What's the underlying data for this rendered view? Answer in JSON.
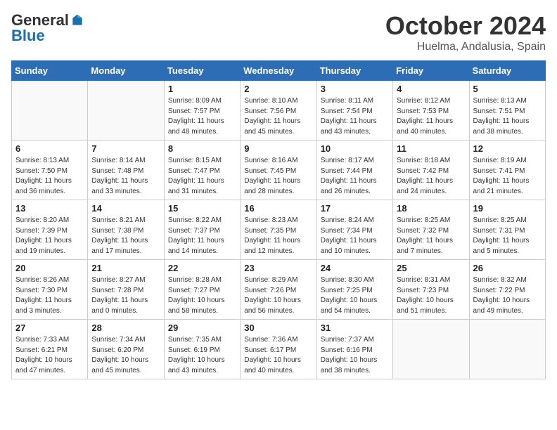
{
  "header": {
    "logo_general": "General",
    "logo_blue": "Blue",
    "title": "October 2024",
    "subtitle": "Huelma, Andalusia, Spain"
  },
  "weekdays": [
    "Sunday",
    "Monday",
    "Tuesday",
    "Wednesday",
    "Thursday",
    "Friday",
    "Saturday"
  ],
  "weeks": [
    [
      {
        "day": "",
        "info": ""
      },
      {
        "day": "",
        "info": ""
      },
      {
        "day": "1",
        "info": "Sunrise: 8:09 AM\nSunset: 7:57 PM\nDaylight: 11 hours and 48 minutes."
      },
      {
        "day": "2",
        "info": "Sunrise: 8:10 AM\nSunset: 7:56 PM\nDaylight: 11 hours and 45 minutes."
      },
      {
        "day": "3",
        "info": "Sunrise: 8:11 AM\nSunset: 7:54 PM\nDaylight: 11 hours and 43 minutes."
      },
      {
        "day": "4",
        "info": "Sunrise: 8:12 AM\nSunset: 7:53 PM\nDaylight: 11 hours and 40 minutes."
      },
      {
        "day": "5",
        "info": "Sunrise: 8:13 AM\nSunset: 7:51 PM\nDaylight: 11 hours and 38 minutes."
      }
    ],
    [
      {
        "day": "6",
        "info": "Sunrise: 8:13 AM\nSunset: 7:50 PM\nDaylight: 11 hours and 36 minutes."
      },
      {
        "day": "7",
        "info": "Sunrise: 8:14 AM\nSunset: 7:48 PM\nDaylight: 11 hours and 33 minutes."
      },
      {
        "day": "8",
        "info": "Sunrise: 8:15 AM\nSunset: 7:47 PM\nDaylight: 11 hours and 31 minutes."
      },
      {
        "day": "9",
        "info": "Sunrise: 8:16 AM\nSunset: 7:45 PM\nDaylight: 11 hours and 28 minutes."
      },
      {
        "day": "10",
        "info": "Sunrise: 8:17 AM\nSunset: 7:44 PM\nDaylight: 11 hours and 26 minutes."
      },
      {
        "day": "11",
        "info": "Sunrise: 8:18 AM\nSunset: 7:42 PM\nDaylight: 11 hours and 24 minutes."
      },
      {
        "day": "12",
        "info": "Sunrise: 8:19 AM\nSunset: 7:41 PM\nDaylight: 11 hours and 21 minutes."
      }
    ],
    [
      {
        "day": "13",
        "info": "Sunrise: 8:20 AM\nSunset: 7:39 PM\nDaylight: 11 hours and 19 minutes."
      },
      {
        "day": "14",
        "info": "Sunrise: 8:21 AM\nSunset: 7:38 PM\nDaylight: 11 hours and 17 minutes."
      },
      {
        "day": "15",
        "info": "Sunrise: 8:22 AM\nSunset: 7:37 PM\nDaylight: 11 hours and 14 minutes."
      },
      {
        "day": "16",
        "info": "Sunrise: 8:23 AM\nSunset: 7:35 PM\nDaylight: 11 hours and 12 minutes."
      },
      {
        "day": "17",
        "info": "Sunrise: 8:24 AM\nSunset: 7:34 PM\nDaylight: 11 hours and 10 minutes."
      },
      {
        "day": "18",
        "info": "Sunrise: 8:25 AM\nSunset: 7:32 PM\nDaylight: 11 hours and 7 minutes."
      },
      {
        "day": "19",
        "info": "Sunrise: 8:25 AM\nSunset: 7:31 PM\nDaylight: 11 hours and 5 minutes."
      }
    ],
    [
      {
        "day": "20",
        "info": "Sunrise: 8:26 AM\nSunset: 7:30 PM\nDaylight: 11 hours and 3 minutes."
      },
      {
        "day": "21",
        "info": "Sunrise: 8:27 AM\nSunset: 7:28 PM\nDaylight: 11 hours and 0 minutes."
      },
      {
        "day": "22",
        "info": "Sunrise: 8:28 AM\nSunset: 7:27 PM\nDaylight: 10 hours and 58 minutes."
      },
      {
        "day": "23",
        "info": "Sunrise: 8:29 AM\nSunset: 7:26 PM\nDaylight: 10 hours and 56 minutes."
      },
      {
        "day": "24",
        "info": "Sunrise: 8:30 AM\nSunset: 7:25 PM\nDaylight: 10 hours and 54 minutes."
      },
      {
        "day": "25",
        "info": "Sunrise: 8:31 AM\nSunset: 7:23 PM\nDaylight: 10 hours and 51 minutes."
      },
      {
        "day": "26",
        "info": "Sunrise: 8:32 AM\nSunset: 7:22 PM\nDaylight: 10 hours and 49 minutes."
      }
    ],
    [
      {
        "day": "27",
        "info": "Sunrise: 7:33 AM\nSunset: 6:21 PM\nDaylight: 10 hours and 47 minutes."
      },
      {
        "day": "28",
        "info": "Sunrise: 7:34 AM\nSunset: 6:20 PM\nDaylight: 10 hours and 45 minutes."
      },
      {
        "day": "29",
        "info": "Sunrise: 7:35 AM\nSunset: 6:19 PM\nDaylight: 10 hours and 43 minutes."
      },
      {
        "day": "30",
        "info": "Sunrise: 7:36 AM\nSunset: 6:17 PM\nDaylight: 10 hours and 40 minutes."
      },
      {
        "day": "31",
        "info": "Sunrise: 7:37 AM\nSunset: 6:16 PM\nDaylight: 10 hours and 38 minutes."
      },
      {
        "day": "",
        "info": ""
      },
      {
        "day": "",
        "info": ""
      }
    ]
  ]
}
